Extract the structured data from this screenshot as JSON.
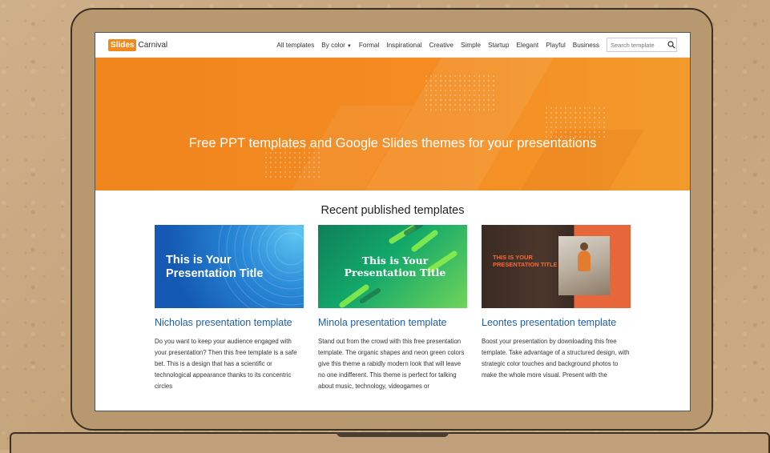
{
  "navbar": {
    "logo_part1": "Slides",
    "logo_part2": "Carnival",
    "links": [
      "All templates",
      "By color",
      "Formal",
      "Inspirational",
      "Creative",
      "Simple",
      "Startup",
      "Elegant",
      "Playful",
      "Business"
    ],
    "search_placeholder": "Search template",
    "dropdown_link_index": 1
  },
  "hero": {
    "title": "Free PPT templates and Google Slides themes for your presentations"
  },
  "section": {
    "title": "Recent published templates"
  },
  "cards": [
    {
      "thumb_text": "This is Your Presentation Title",
      "title": "Nicholas presentation template",
      "description": "Do you want to keep your audience engaged with your presentation? Then this free template is a safe bet. This is a design that has a scientific or technological appearance thanks to its concentric circles"
    },
    {
      "thumb_text": "This is Your Presentation Title",
      "title": "Minola presentation template",
      "description": "Stand out from the crowd with this free presentation template. The organic shapes and neon green colors give this theme a rabidly modern look that will leave no one indifferent. This theme is perfect for talking about music, technology, videogames or"
    },
    {
      "thumb_text": "THIS IS YOUR PRESENTATION TITLE",
      "title": "Leontes presentation template",
      "description": "Boost your presentation by downloading this free template. Take advantage of a structured design, with strategic color touches and background photos to make the whole more visual. Present with the"
    }
  ],
  "colors": {
    "brand_orange": "#f08a1e",
    "link_blue": "#1f5fa8",
    "hero_bg": "#f0841d"
  }
}
